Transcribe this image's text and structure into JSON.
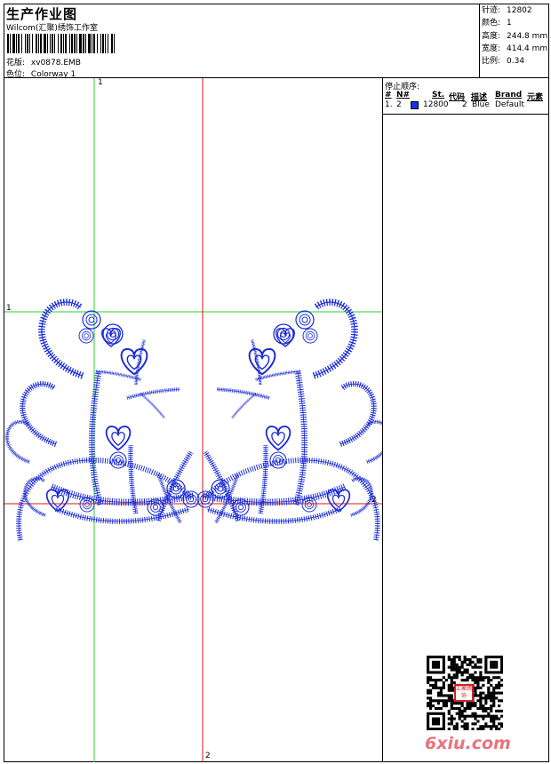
{
  "header": {
    "title": "生产作业图",
    "company": "Wilcom(汇聚)绣饰工作室",
    "design_label": "花版:",
    "design_value": "xv0878.EMB",
    "colorway_label": "色位:",
    "colorway_value": "Colorway 1"
  },
  "specs": [
    {
      "label": "针迹:",
      "value": "12802"
    },
    {
      "label": "颜色:",
      "value": "1"
    },
    {
      "label": "高度:",
      "value": "244.8 mm"
    },
    {
      "label": "宽度:",
      "value": "414.4 mm"
    },
    {
      "label": "比例:",
      "value": "0.34"
    }
  ],
  "stop_sequence": {
    "title": "停止顺序:",
    "columns": [
      "#",
      "N#",
      "St.",
      "代码",
      "描述",
      "Brand",
      "元素"
    ],
    "rows": [
      {
        "index": "1.",
        "needle": "2",
        "swatch_color": "#1430ff",
        "stitches": "12800",
        "code": "2",
        "description": "Blue",
        "brand": "Default",
        "element": ""
      }
    ]
  },
  "axes": {
    "top_marker": "1",
    "left_marker": "1",
    "right_marker": "2",
    "bottom_marker": "2"
  },
  "footer": {
    "brand": "6xiu.com",
    "seal_text": "汇聚绣饰"
  },
  "colors": {
    "stitch": "#1a2bd6",
    "guide_green": "#2fd12f",
    "guide_red": "#e01010"
  }
}
